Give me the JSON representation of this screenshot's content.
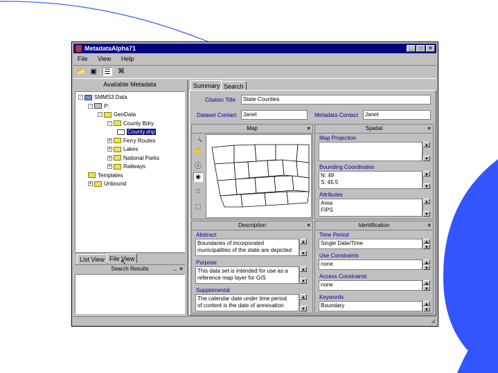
{
  "window": {
    "title": "MetadataAlpha71",
    "controls": [
      "_",
      "□",
      "×"
    ]
  },
  "menu": [
    "File",
    "View",
    "Help"
  ],
  "toolbar_icons": [
    "open-icon",
    "save-icon",
    "list-icon",
    "network-icon"
  ],
  "left": {
    "header": "Available Metadata",
    "tree": [
      {
        "label": "SMMS3 Data",
        "depth": 0,
        "toggle": "-"
      },
      {
        "label": "P:",
        "depth": 1,
        "toggle": "-"
      },
      {
        "label": "GeoData",
        "depth": 2,
        "toggle": "-"
      },
      {
        "label": "County Bdry",
        "depth": 3,
        "toggle": "-"
      },
      {
        "label": "County.shp",
        "depth": 4,
        "toggle": "",
        "selected": true
      },
      {
        "label": "Ferry Routes",
        "depth": 3,
        "toggle": "+"
      },
      {
        "label": "Lakes",
        "depth": 3,
        "toggle": "+"
      },
      {
        "label": "National Parks",
        "depth": 3,
        "toggle": "+"
      },
      {
        "label": "Railways",
        "depth": 3,
        "toggle": "+"
      },
      {
        "label": "Templates",
        "depth": 1,
        "toggle": ""
      },
      {
        "label": "Unbound",
        "depth": 1,
        "toggle": "+"
      }
    ],
    "tabs": [
      "List View",
      "File View"
    ],
    "search_results": "Search Results"
  },
  "right": {
    "tabs": [
      "Summary",
      "Search"
    ],
    "citation_title_label": "Citation Title",
    "citation_title": "State Counties",
    "dataset_contact_label": "Dataset Contact",
    "dataset_contact": "Janet",
    "metadata_contact_label": "Metadata Contact",
    "metadata_contact": "Janet",
    "map": {
      "header": "Map"
    },
    "spatial": {
      "header": "Spatial",
      "map_projection_label": "Map Projection",
      "map_projection": "",
      "bounding_label": "Bounding Coordinates",
      "bounding": [
        "N: 49",
        "S: 45.5"
      ],
      "attributes_label": "Attributes",
      "attributes": [
        "Area",
        "FIPS"
      ]
    },
    "description": {
      "header": "Description",
      "abstract_label": "Abstract",
      "abstract": [
        "Boundaries of incorporated",
        "municipalities of the state are depicted"
      ],
      "purpose_label": "Purpose",
      "purpose": [
        "This data set is intended for use as a",
        "reference map layer for GIS"
      ],
      "supplemental_label": "Supplemental",
      "supplemental": [
        "The calendar date under time period",
        "of content is the date of annexation"
      ]
    },
    "identification": {
      "header": "Identification",
      "time_period_label": "Time Period",
      "time_period": "Single Date/Time",
      "use_constraints_label": "Use Constraints",
      "use_constraints": "none",
      "access_constraints_label": "Access Constraints",
      "access_constraints": "none",
      "keywords_label": "Keywords",
      "keywords": "Boundary"
    }
  },
  "colors": {
    "titlebar": "#000080",
    "accent_blue": "#3355ff",
    "label_blue": "#0000a0"
  }
}
